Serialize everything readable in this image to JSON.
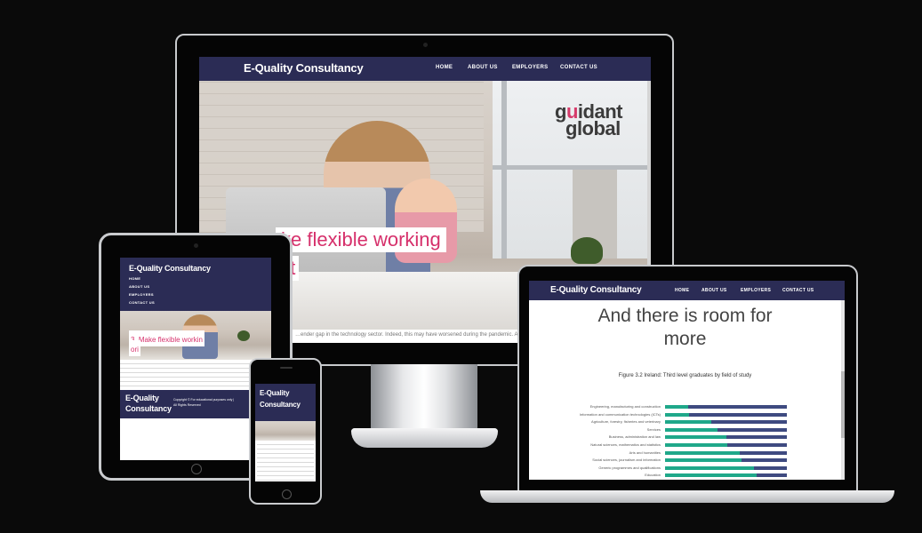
{
  "brand": "E-Quality Consultancy",
  "nav": [
    "HOME",
    "ABOUT US",
    "EMPLOYERS",
    "CONTACT US"
  ],
  "logo": {
    "line1a": "g",
    "line1b": "u",
    "line1c": "idant",
    "line2": "global"
  },
  "hero": {
    "headline_1": "ke flexible working",
    "headline_2": "rit",
    "caption": "…ender gap in the technology sector. Indeed, this may have worsened during the pandemic. Almost 85%"
  },
  "tablet": {
    "step": "3. Make flexible workin",
    "step2": "ori",
    "footer_brand_1": "E-Quality",
    "footer_brand_2": "Consultancy",
    "copyright_1": "Copyright © For educational purposes only |",
    "copyright_2": "All Rights Reserved"
  },
  "phone": {
    "brand_1": "E-Quality",
    "brand_2": "Consultancy"
  },
  "laptop": {
    "heading_1": "And there is room for",
    "heading_2": "more",
    "figure_title": "Figure 3.2 Ireland: Third level graduates by field of study",
    "chart_data": {
      "type": "bar",
      "title": "Figure 3.2 Ireland: Third level graduates by field of study",
      "categories": [
        "Engineering, manufacturing and construction",
        "Information and communication technologies (ICTs)",
        "Agriculture, forestry, fisheries and veterinary",
        "Services",
        "Business, administration and law",
        "Natural sciences, mathematics and statistics",
        "Arts and humanities",
        "Social sciences, journalism and information",
        "Generic programmes and qualifications",
        "Education"
      ],
      "series": [
        {
          "values": [
            19,
            20,
            38,
            43,
            50,
            51,
            61,
            63,
            73,
            75
          ]
        },
        {
          "values": [
            81,
            80,
            62,
            57,
            50,
            49,
            39,
            37,
            27,
            25
          ]
        }
      ],
      "ylim": [
        0,
        100
      ],
      "colors": [
        "#1fa88a",
        "#3e4a80"
      ]
    }
  }
}
